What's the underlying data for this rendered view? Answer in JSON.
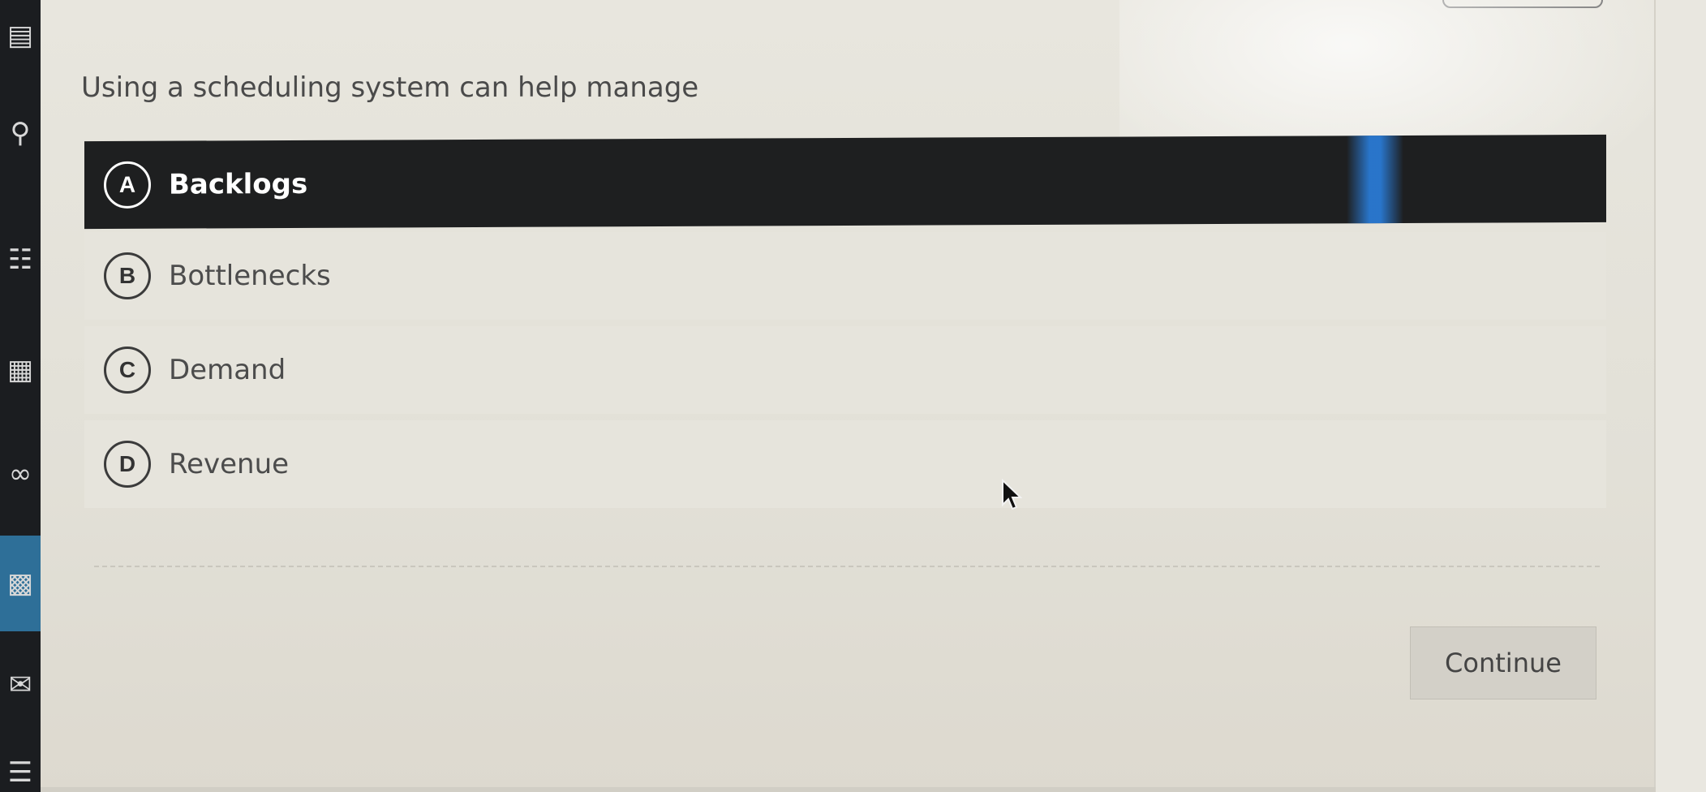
{
  "question": {
    "text": "Using a scheduling system can help manage"
  },
  "options": [
    {
      "letter": "A",
      "label": "Backlogs",
      "selected": true
    },
    {
      "letter": "B",
      "label": "Bottlenecks",
      "selected": false
    },
    {
      "letter": "C",
      "label": "Demand",
      "selected": false
    },
    {
      "letter": "D",
      "label": "Revenue",
      "selected": false
    }
  ],
  "actions": {
    "continue_label": "Continue"
  },
  "sidebar": {
    "icons": [
      "book-icon",
      "search-icon",
      "globe-icon",
      "calculator-icon",
      "people-icon",
      "calendar-icon",
      "mail-icon",
      "document-icon"
    ],
    "active": "calendar-icon"
  },
  "colors": {
    "selected_background": "#1e1f20",
    "option_background": "#e6e4dc",
    "sidebar_background": "#1b1d20",
    "sidebar_active": "#2e6f98"
  }
}
